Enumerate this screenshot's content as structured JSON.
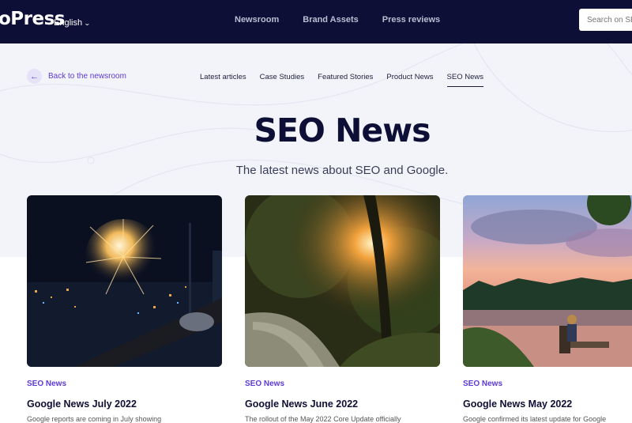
{
  "header": {
    "logo_text": "oPress",
    "language_label": "English",
    "nav": [
      "Newsroom",
      "Brand Assets",
      "Press reviews"
    ],
    "search_placeholder": "Search on SEO"
  },
  "hero": {
    "back_label": "Back to the newsroom",
    "tabs": [
      "Latest articles",
      "Case Studies",
      "Featured Stories",
      "Product News",
      "SEO News"
    ],
    "active_tab": "SEO News",
    "title": "SEO News",
    "subtitle": "The latest news about SEO and Google."
  },
  "cards": [
    {
      "category": "SEO News",
      "title": "Google News July 2022",
      "excerpt": "Google reports are coming in July showing",
      "image": "fireworks over city at night"
    },
    {
      "category": "SEO News",
      "title": "Google News June 2022",
      "excerpt": "The rollout of the May 2022 Core Update officially",
      "image": "sunset through trees on a path"
    },
    {
      "category": "SEO News",
      "title": "Google News May 2022",
      "excerpt": "Google confirmed its latest update for Google",
      "image": "person sitting by lake at sunset"
    }
  ],
  "colors": {
    "header_bg": "#0e0f36",
    "accent": "#5b3ad6",
    "hero_bg": "#f3f4fa"
  }
}
